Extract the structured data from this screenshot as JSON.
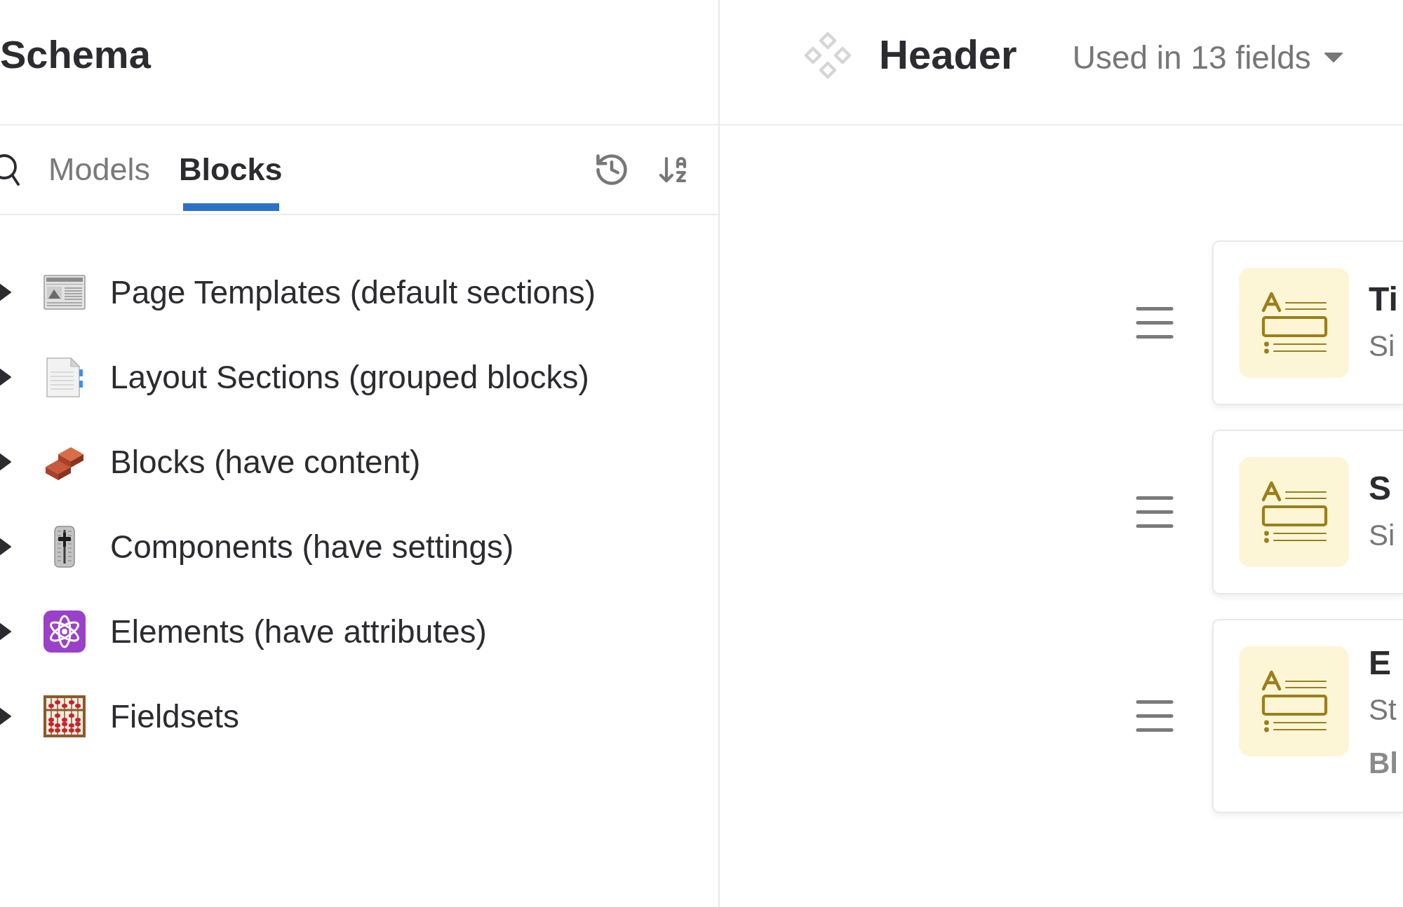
{
  "sidebar": {
    "title": "Schema",
    "tabs": [
      {
        "label": "Models",
        "selected": false
      },
      {
        "label": "Blocks",
        "selected": true
      }
    ],
    "items": [
      {
        "label": "Page Templates (default sections)",
        "expanded": false
      },
      {
        "label": "Layout Sections (grouped blocks)",
        "expanded": false
      },
      {
        "label": "Blocks (have content)",
        "expanded": false
      },
      {
        "label": "Components (have settings)",
        "expanded": false
      },
      {
        "label": "Elements (have attributes)",
        "expanded": false
      },
      {
        "label": "Fieldsets",
        "expanded": false
      }
    ]
  },
  "editor": {
    "title": "Header",
    "usage": "Used in 13 fields",
    "fields": [
      {
        "title": "Ti",
        "subtitle": "Si"
      },
      {
        "title": "S",
        "subtitle": "Si"
      },
      {
        "title": "E",
        "subtitle": "St",
        "line_3": "Bl"
      }
    ]
  }
}
